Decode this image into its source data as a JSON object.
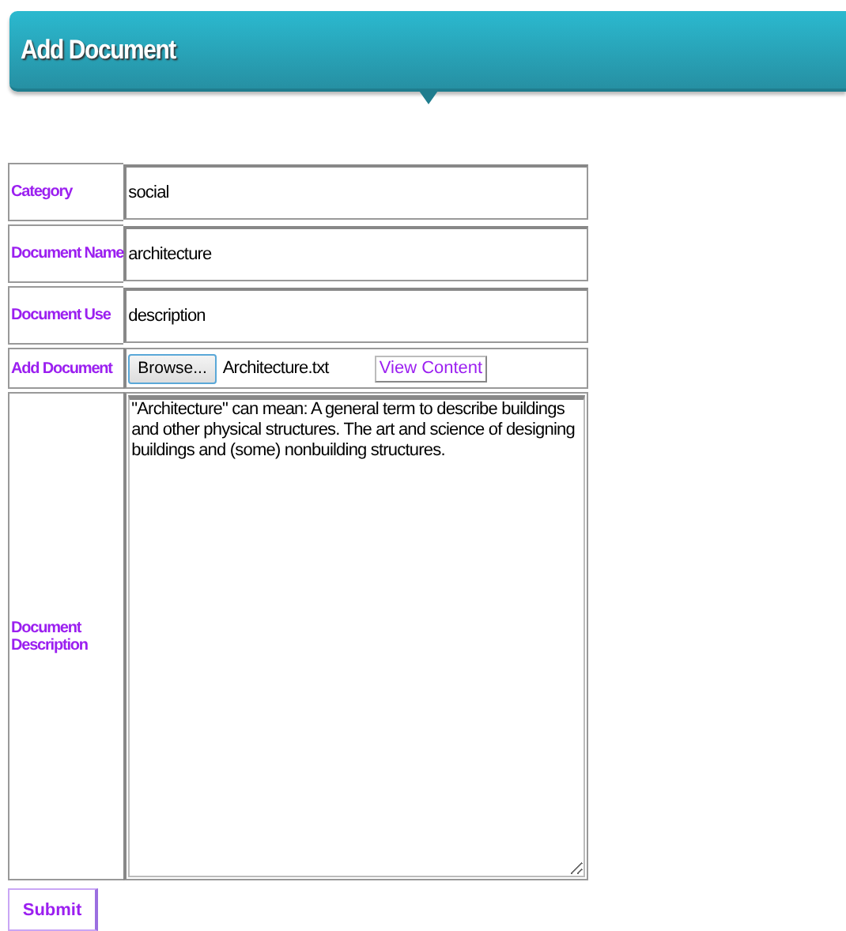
{
  "header": {
    "title": "Add Document"
  },
  "fields": [
    {
      "kind": "text",
      "label": "Category",
      "value": "social"
    },
    {
      "kind": "text",
      "label": "Document Name",
      "value": "architecture"
    },
    {
      "kind": "text",
      "label": "Document Use",
      "value": "description"
    },
    {
      "kind": "file",
      "label": "Add Document",
      "button": "Browse...",
      "file_name": "Architecture.txt",
      "link": "View Content"
    },
    {
      "kind": "textarea",
      "label": "Document Description",
      "value": "\"Architecture\" can mean: A general term to describe buildings and other physical structures. The art and science of designing buildings and (some) nonbuilding structures."
    }
  ],
  "submit": "Submit"
}
